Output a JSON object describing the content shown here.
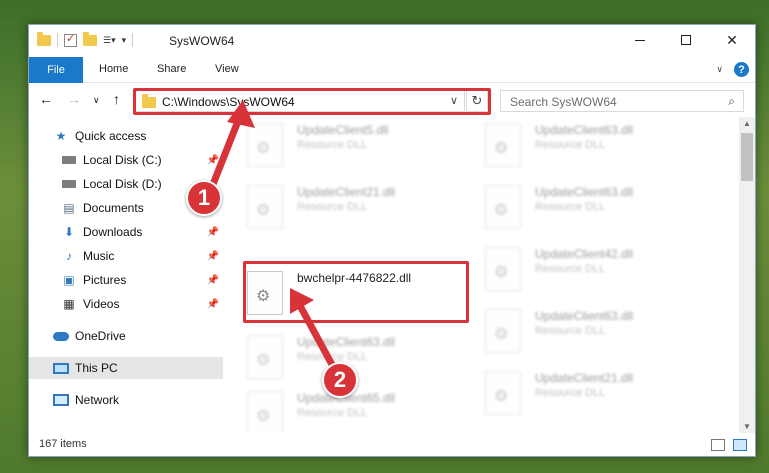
{
  "window": {
    "title": "SysWOW64"
  },
  "ribbon": {
    "file_tab": "File",
    "tabs": [
      "Home",
      "Share",
      "View"
    ]
  },
  "address": {
    "path": "C:\\Windows\\SysWOW64",
    "search_placeholder": "Search SysWOW64"
  },
  "sidebar": {
    "quick_access": "Quick access",
    "items": [
      {
        "label": "Local Disk (C:)",
        "pinned": true
      },
      {
        "label": "Local Disk (D:)",
        "pinned": false
      },
      {
        "label": "Documents",
        "pinned": true
      },
      {
        "label": "Downloads",
        "pinned": true
      },
      {
        "label": "Music",
        "pinned": true
      },
      {
        "label": "Pictures",
        "pinned": true
      },
      {
        "label": "Videos",
        "pinned": true
      }
    ],
    "onedrive": "OneDrive",
    "this_pc": "This PC",
    "network": "Network"
  },
  "files": {
    "left": [
      {
        "name": "UpdateClient5.dll",
        "desc": "Resource DLL"
      },
      {
        "name": "UpdateClient21.dll",
        "desc": "Resource DLL"
      },
      {
        "name": "bwchelpr-4476822.dll",
        "desc": ""
      },
      {
        "name": "UpdateClient63.dll",
        "desc": "Resource DLL"
      },
      {
        "name": "UpdateClient65.dll",
        "desc": "Resource DLL"
      }
    ],
    "right": [
      {
        "name": "UpdateClient63.dll",
        "desc": "Resource DLL"
      },
      {
        "name": "UpdateClient63.dll",
        "desc": "Resource DLL"
      },
      {
        "name": "UpdateClient42.dll",
        "desc": "Resource DLL"
      },
      {
        "name": "UpdateClient63.dll",
        "desc": "Resource DLL"
      },
      {
        "name": "UpdateClient21.dll",
        "desc": "Resource DLL"
      }
    ]
  },
  "status": {
    "item_count": "167 items"
  },
  "annotations": {
    "step1": "1",
    "step2": "2"
  },
  "colors": {
    "accent": "#1979ca",
    "highlight": "#d9333a"
  }
}
